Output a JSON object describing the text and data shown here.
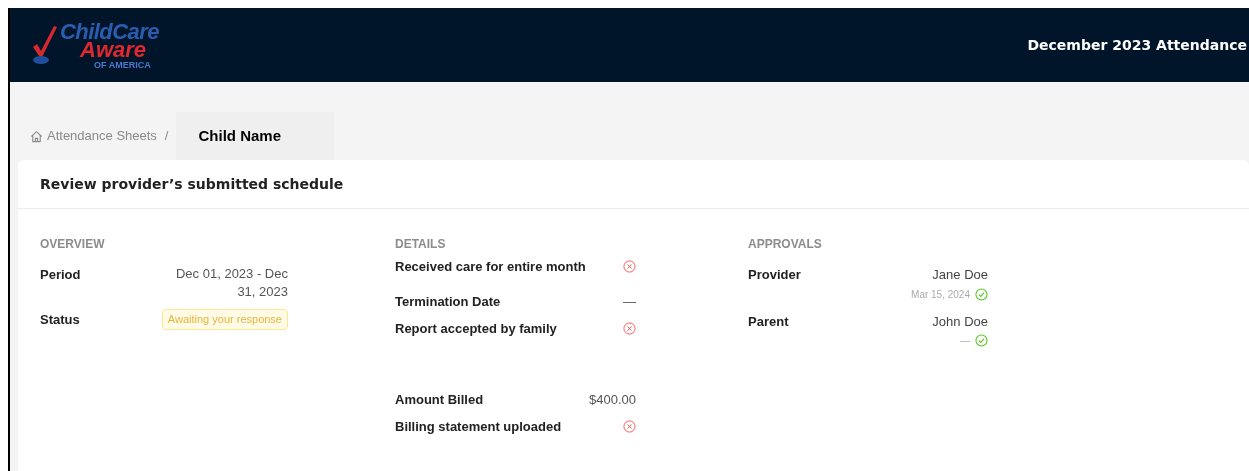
{
  "logo": {
    "line_1": "ChildCare",
    "line_2": "Aware",
    "line_3": "OF AMERICA"
  },
  "header": {
    "title": "December 2023 Attendance"
  },
  "breadcrumb": {
    "parent": "Attendance Sheets",
    "separator": "/",
    "current": "Child Name"
  },
  "card": {
    "title": "Review provider’s submitted schedule"
  },
  "overview": {
    "heading": "OVERVIEW",
    "period_label": "Period",
    "period_value": "Dec 01, 2023 - Dec 31, 2023",
    "status_label": "Status",
    "status_value": "Awaiting your response"
  },
  "details": {
    "heading": "DETAILS",
    "rows": [
      {
        "label": "Received care for entire month",
        "kind": "check",
        "checked": false
      },
      {
        "label": "Termination Date",
        "kind": "text",
        "value": "—"
      },
      {
        "label": "Report accepted by family",
        "kind": "check",
        "checked": false
      },
      {
        "label": "Amount Billed",
        "kind": "text",
        "value": "$400.00"
      },
      {
        "label": "Billing statement uploaded",
        "kind": "check",
        "checked": false
      }
    ]
  },
  "approvals": {
    "heading": "APPROVALS",
    "rows": [
      {
        "role": "Provider",
        "name": "Jane Doe",
        "date": "Mar 15, 2024",
        "approved": true
      },
      {
        "role": "Parent",
        "name": "John Doe",
        "date": "—",
        "approved": true
      }
    ]
  }
}
